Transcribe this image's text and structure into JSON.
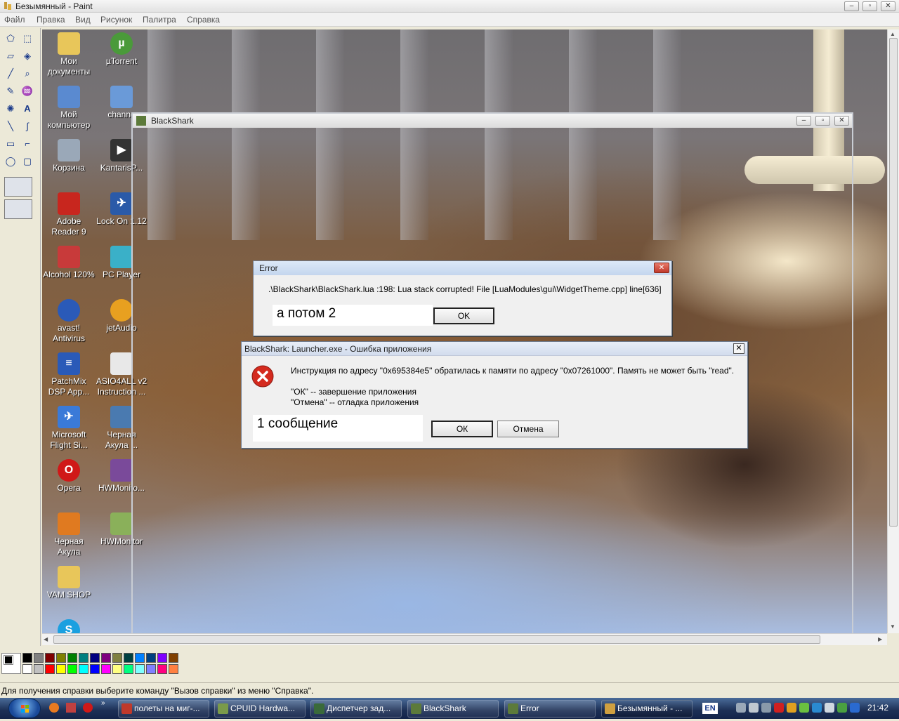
{
  "paint": {
    "title": "Безымянный - Paint",
    "menu": [
      "Файл",
      "Правка",
      "Вид",
      "Рисунок",
      "Палитра",
      "Справка"
    ],
    "status_text": "Для получения справки выберите команду \"Вызов справки\" из меню \"Справка\"."
  },
  "desktop_icons": [
    {
      "label": "Мои документы",
      "icon": "folder-icon"
    },
    {
      "label": "µTorrent",
      "icon": "utorrent-icon"
    },
    {
      "label": "Мой компьютер",
      "icon": "computer-icon"
    },
    {
      "label": "channe",
      "icon": "channel-icon"
    },
    {
      "label": "Корзина",
      "icon": "recycle-bin-icon"
    },
    {
      "label": "KantarisP...",
      "icon": "kantaris-icon"
    },
    {
      "label": "Adobe Reader 9",
      "icon": "adobe-reader-icon"
    },
    {
      "label": "Lock On 1.12",
      "icon": "lockon-icon"
    },
    {
      "label": "Alcohol 120%",
      "icon": "alcohol-icon"
    },
    {
      "label": "PC Player",
      "icon": "pcplayer-icon"
    },
    {
      "label": "avast! Antivirus",
      "icon": "avast-icon"
    },
    {
      "label": "jetAudio",
      "icon": "jetaudio-icon"
    },
    {
      "label": "PatchMix DSP App...",
      "icon": "patchmix-icon"
    },
    {
      "label": "ASIO4ALL v2 Instruction ...",
      "icon": "pdf-icon"
    },
    {
      "label": "Microsoft Flight Si...",
      "icon": "flightsim-icon"
    },
    {
      "label": "Черная Акула ...",
      "icon": "blackshark-icon"
    },
    {
      "label": "Opera",
      "icon": "opera-icon"
    },
    {
      "label": "HWMonito...",
      "icon": "winrar-icon"
    },
    {
      "label": "Черная Акула",
      "icon": "blackshark-icon"
    },
    {
      "label": "HWMonitor",
      "icon": "hwmonitor-icon"
    },
    {
      "label": "VAM SHOP",
      "icon": "folder-icon"
    }
  ],
  "blackshark_window": {
    "title": "BlackShark"
  },
  "error_dialog": {
    "title": "Error",
    "message": ".\\BlackShark\\BlackShark.lua :198: Lua stack corrupted! File [LuaModules\\gui\\WidgetTheme.cpp] line[636]",
    "ok_label": "OK",
    "annotation": "а потом 2"
  },
  "app_error_dialog": {
    "title": "BlackShark: Launcher.exe - Ошибка приложения",
    "message": "Инструкция по адресу \"0x695384e5\" обратилась к памяти по адресу \"0x07261000\". Память не может быть \"read\".",
    "ok_hint": "\"ОК\" -- завершение приложения",
    "cancel_hint": "\"Отмена\" -- отладка приложения",
    "ok_label": "ОК",
    "cancel_label": "Отмена",
    "annotation": "1 сообщение"
  },
  "taskbar": {
    "tasks": [
      {
        "label": "полеты на миг-...",
        "color": "#c0392b"
      },
      {
        "label": "CPUID Hardwa...",
        "color": "#7a9a4a"
      },
      {
        "label": "Диспетчер зад...",
        "color": "#3a6a3a"
      },
      {
        "label": "BlackShark",
        "color": "#5c7a3a"
      },
      {
        "label": "Error",
        "color": "#5c7a3a"
      },
      {
        "label": "Безымянный - ...",
        "color": "#d0a040"
      }
    ],
    "language": "EN",
    "clock": "21:42"
  },
  "palette_colors": [
    "#000000",
    "#808080",
    "#800000",
    "#808000",
    "#008000",
    "#008080",
    "#000080",
    "#800080",
    "#808040",
    "#004040",
    "#0080ff",
    "#004080",
    "#8000ff",
    "#804000",
    "#ffffff",
    "#c0c0c0",
    "#ff0000",
    "#ffff00",
    "#00ff00",
    "#00ffff",
    "#0000ff",
    "#ff00ff",
    "#ffff80",
    "#00ff80",
    "#80ffff",
    "#8080ff",
    "#ff0080",
    "#ff8040"
  ]
}
